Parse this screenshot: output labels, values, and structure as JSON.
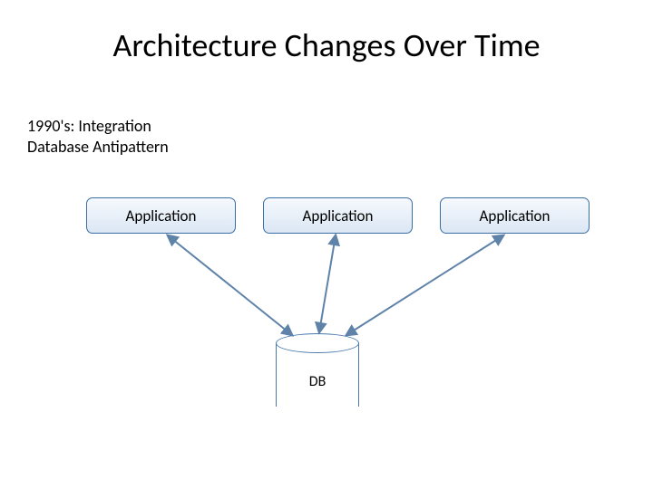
{
  "title": "Architecture Changes Over Time",
  "subtitle": "1990's: Integration\nDatabase Antipattern",
  "boxes": {
    "app1": "Application",
    "app2": "Application",
    "app3": "Application"
  },
  "db": {
    "label": "DB"
  },
  "colors": {
    "box_border": "#3b6ea5",
    "box_fill_top": "#f6f9fd",
    "box_fill_bottom": "#dbe7f4",
    "arrow": "#5e82a8"
  }
}
